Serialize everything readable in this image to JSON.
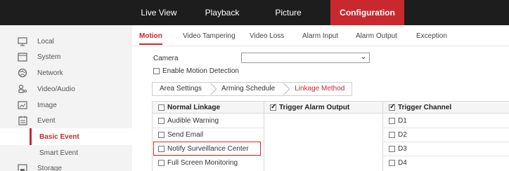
{
  "topnav": {
    "items": [
      {
        "label": "Live View",
        "active": false
      },
      {
        "label": "Playback",
        "active": false
      },
      {
        "label": "Picture",
        "active": false
      },
      {
        "label": "Configuration",
        "active": true
      }
    ]
  },
  "sidebar": {
    "items": [
      {
        "label": "Local",
        "icon": "monitor-icon"
      },
      {
        "label": "System",
        "icon": "system-icon"
      },
      {
        "label": "Network",
        "icon": "globe-icon"
      },
      {
        "label": "Video/Audio",
        "icon": "video-audio-icon"
      },
      {
        "label": "Image",
        "icon": "image-icon"
      },
      {
        "label": "Event",
        "icon": "calendar-icon"
      },
      {
        "label": "Basic Event",
        "active": true
      },
      {
        "label": "Smart Event"
      },
      {
        "label": "Storage",
        "icon": "storage-icon"
      }
    ]
  },
  "subtabs": [
    {
      "label": "Motion",
      "active": true
    },
    {
      "label": "Video Tampering"
    },
    {
      "label": "Video Loss"
    },
    {
      "label": "Alarm Input"
    },
    {
      "label": "Alarm Output"
    },
    {
      "label": "Exception"
    }
  ],
  "camera": {
    "label": "Camera",
    "value": ""
  },
  "enable_motion": {
    "label": "Enable Motion Detection",
    "checked": false
  },
  "steps": [
    {
      "label": "Area Settings"
    },
    {
      "label": "Arming Schedule"
    },
    {
      "label": "Linkage Method",
      "active": true
    }
  ],
  "linkage": {
    "headers": [
      {
        "label": "Normal Linkage",
        "checked": false
      },
      {
        "label": "Trigger Alarm Output",
        "checked": true
      },
      {
        "label": "Trigger Channel",
        "checked": true
      }
    ],
    "normal": [
      {
        "label": "Audible Warning",
        "checked": false
      },
      {
        "label": "Send Email",
        "checked": false
      },
      {
        "label": "Notify Surveillance Center",
        "checked": false
      },
      {
        "label": "Full Screen Monitoring",
        "checked": false
      }
    ],
    "channels": [
      {
        "label": "D1",
        "checked": false
      },
      {
        "label": "D2",
        "checked": false
      },
      {
        "label": "D3",
        "checked": false
      },
      {
        "label": "D4",
        "checked": false
      }
    ]
  },
  "colors": {
    "accent": "#c8282e",
    "topbar": "#1d1d1d",
    "sidebar": "#f3f3f3"
  }
}
